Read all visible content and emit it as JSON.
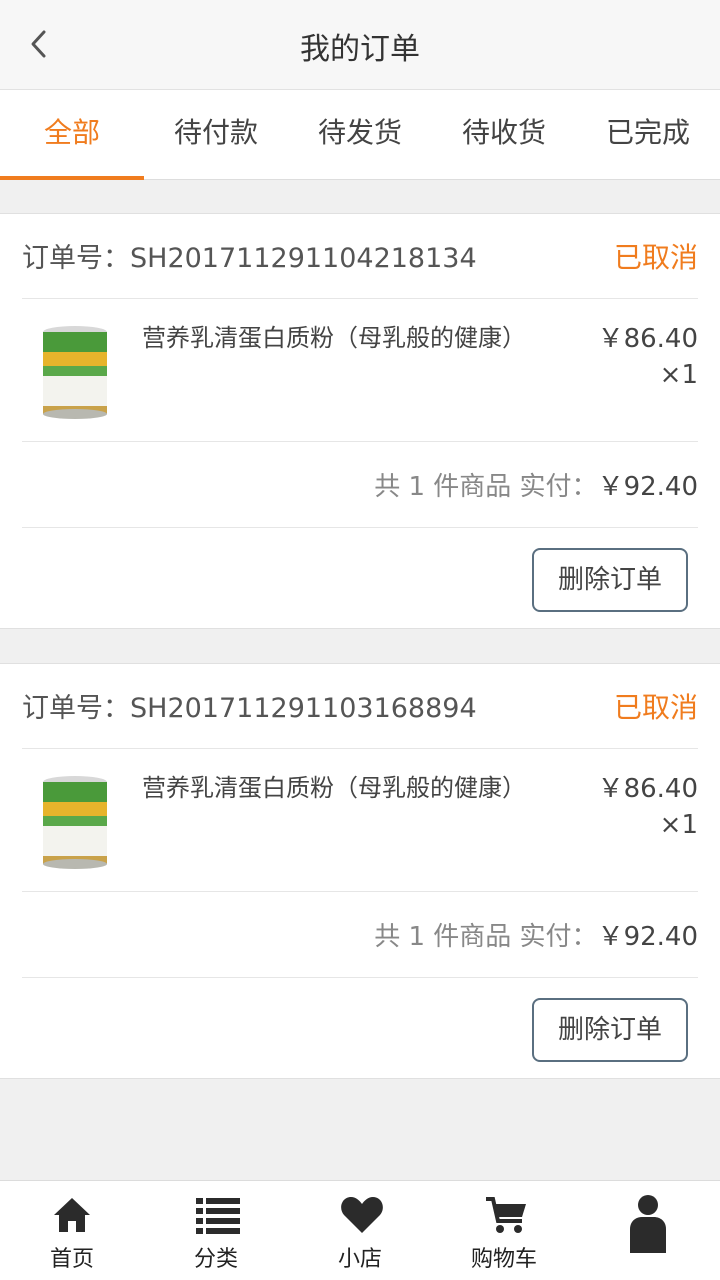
{
  "header": {
    "title": "我的订单"
  },
  "tabs": [
    {
      "label": "全部",
      "active": true
    },
    {
      "label": "待付款"
    },
    {
      "label": "待发货"
    },
    {
      "label": "待收货"
    },
    {
      "label": "已完成"
    }
  ],
  "orders": [
    {
      "order_label": "订单号：SH201711291104218134",
      "status": "已取消",
      "item_name": "营养乳清蛋白质粉（母乳般的健康）",
      "price": "￥86.40",
      "qty": "×1",
      "summary_count": "共 1 件商品 实付：",
      "summary_total": "￥92.40",
      "delete_label": "删除订单"
    },
    {
      "order_label": "订单号：SH201711291103168894",
      "status": "已取消",
      "item_name": "营养乳清蛋白质粉（母乳般的健康）",
      "price": "￥86.40",
      "qty": "×1",
      "summary_count": "共 1 件商品 实付：",
      "summary_total": "￥92.40",
      "delete_label": "删除订单"
    }
  ],
  "tabbar": [
    {
      "label": "首页",
      "icon": "home-icon"
    },
    {
      "label": "分类",
      "icon": "list-icon"
    },
    {
      "label": "小店",
      "icon": "heart-icon"
    },
    {
      "label": "购物车",
      "icon": "cart-icon"
    },
    {
      "label": "",
      "icon": "user-icon"
    }
  ],
  "colors": {
    "accent": "#f07c1e",
    "button_border": "#5a6f80"
  }
}
